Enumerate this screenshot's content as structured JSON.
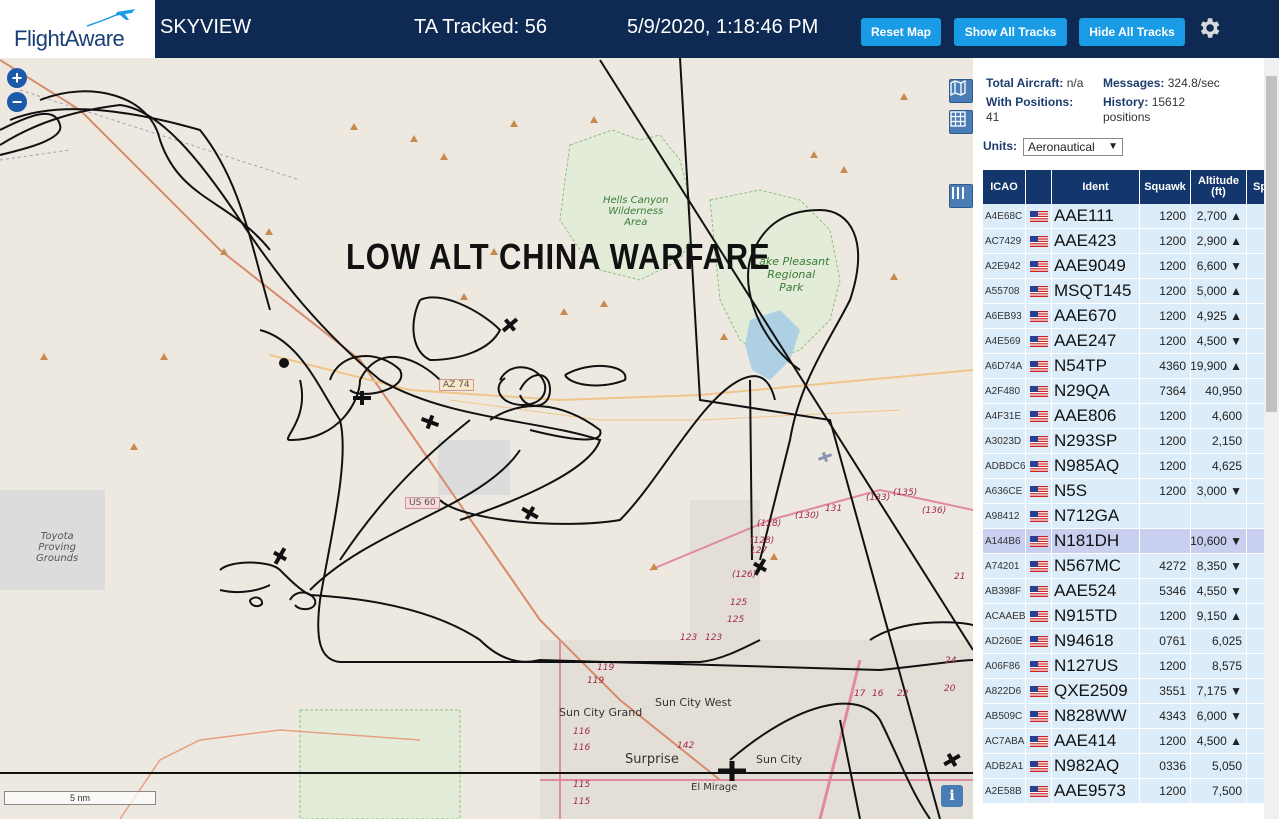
{
  "header": {
    "logo_text": "FlightAware",
    "app_title": "SKYVIEW",
    "tracked": "TA Tracked: 56",
    "datetime": "5/9/2020, 1:18:46 PM",
    "reset_map": "Reset Map",
    "show_all": "Show All Tracks",
    "hide_all": "Hide All Tracks"
  },
  "map": {
    "overlay_title": "LOW ALT CHINA WARFARE",
    "zoom_in": "+",
    "zoom_out": "−",
    "scale_label": "5 nm",
    "info": "i",
    "labels": {
      "hells_canyon": "Hells Canyon\nWilderness\nArea",
      "lake_pleasant": "Lake Pleasant\nRegional\nPark",
      "toyota": "Toyota\nProving\nGrounds",
      "az74": "AZ 74",
      "us60": "US 60",
      "sun_city_grand": "Sun City Grand",
      "sun_city_west": "Sun City West",
      "surprise": "Surprise",
      "sun_city": "Sun City",
      "el_mirage": "El Mirage"
    },
    "routes": [
      "(128)",
      "(130)",
      "131",
      "(133)",
      "(135)",
      "(136)",
      "(128)",
      "127",
      "(126)",
      "125",
      "125",
      "123",
      "123",
      "119",
      "119",
      "116",
      "116",
      "115",
      "115",
      "142",
      "17",
      "16",
      "22",
      "20",
      "21",
      "24"
    ]
  },
  "panel": {
    "total_aircraft_label": "Total Aircraft:",
    "total_aircraft_value": "n/a",
    "messages_label": "Messages:",
    "messages_value": "324.8/sec",
    "with_positions_label": "With Positions:",
    "with_positions_value": "41",
    "history_label": "History:",
    "history_value": "15612 positions",
    "units_label": "Units:",
    "units_value": "Aeronautical",
    "columns": [
      "ICAO",
      "",
      "Ident",
      "Squawk",
      "Altitude (ft)",
      "Sp"
    ],
    "rows": [
      {
        "icao": "A4E68C",
        "ident": "AAE111",
        "squawk": "1200",
        "alt": "2,700 ▲"
      },
      {
        "icao": "AC7429",
        "ident": "AAE423",
        "squawk": "1200",
        "alt": "2,900 ▲"
      },
      {
        "icao": "A2E942",
        "ident": "AAE9049",
        "squawk": "1200",
        "alt": "6,600 ▼"
      },
      {
        "icao": "A55708",
        "ident": "MSQT145",
        "squawk": "1200",
        "alt": "5,000 ▲"
      },
      {
        "icao": "A6EB93",
        "ident": "AAE670",
        "squawk": "1200",
        "alt": "4,925 ▲"
      },
      {
        "icao": "A4E569",
        "ident": "AAE247",
        "squawk": "1200",
        "alt": "4,500 ▼"
      },
      {
        "icao": "A6D74A",
        "ident": "N54TP",
        "squawk": "4360",
        "alt": "19,900 ▲"
      },
      {
        "icao": "A2F480",
        "ident": "N29QA",
        "squawk": "7364",
        "alt": "40,950"
      },
      {
        "icao": "A4F31E",
        "ident": "AAE806",
        "squawk": "1200",
        "alt": "4,600"
      },
      {
        "icao": "A3023D",
        "ident": "N293SP",
        "squawk": "1200",
        "alt": "2,150"
      },
      {
        "icao": "ADBDC6",
        "ident": "N985AQ",
        "squawk": "1200",
        "alt": "4,625"
      },
      {
        "icao": "A636CE",
        "ident": "N5S",
        "squawk": "1200",
        "alt": "3,000 ▼"
      },
      {
        "icao": "A98412",
        "ident": "N712GA",
        "squawk": "",
        "alt": ""
      },
      {
        "icao": "A144B6",
        "ident": "N181DH",
        "squawk": "",
        "alt": "10,600 ▼",
        "selected": true
      },
      {
        "icao": "A74201",
        "ident": "N567MC",
        "squawk": "4272",
        "alt": "8,350 ▼"
      },
      {
        "icao": "AB398F",
        "ident": "AAE524",
        "squawk": "5346",
        "alt": "4,550 ▼"
      },
      {
        "icao": "ACAAEB",
        "ident": "N915TD",
        "squawk": "1200",
        "alt": "9,150 ▲"
      },
      {
        "icao": "AD260E",
        "ident": "N94618",
        "squawk": "0761",
        "alt": "6,025"
      },
      {
        "icao": "A06F86",
        "ident": "N127US",
        "squawk": "1200",
        "alt": "8,575"
      },
      {
        "icao": "A822D6",
        "ident": "QXE2509",
        "squawk": "3551",
        "alt": "7,175 ▼"
      },
      {
        "icao": "AB509C",
        "ident": "N828WW",
        "squawk": "4343",
        "alt": "6,000 ▼"
      },
      {
        "icao": "AC7ABA",
        "ident": "AAE414",
        "squawk": "1200",
        "alt": "4,500 ▲"
      },
      {
        "icao": "ADB2A1",
        "ident": "N982AQ",
        "squawk": "0336",
        "alt": "5,050"
      },
      {
        "icao": "A2E58B",
        "ident": "AAE9573",
        "squawk": "1200",
        "alt": "7,500"
      }
    ]
  },
  "colors": {
    "header_bg": "#0e2a52",
    "button_bg": "#1a9be6",
    "table_header": "#13376d",
    "row_bg": "#dcecf8",
    "row_selected": "#c8cfef",
    "track": "#111111"
  }
}
